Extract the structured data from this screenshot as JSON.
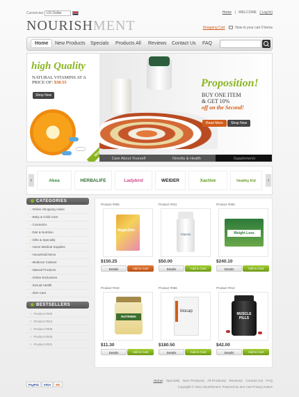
{
  "header": {
    "currencies_label": "Currencies:",
    "currency_value": "US Dollar",
    "logo_part1": "Nourish",
    "logo_part2": "ment",
    "links": {
      "home": "Home",
      "sep": "|",
      "welcome": "WELCOME",
      "login": "( Log In)"
    },
    "shopping_cart": "Shopping Cart",
    "cart_status": "Now in your cart 0 items"
  },
  "nav": {
    "items": [
      "Home",
      "New Products",
      "Specials",
      "Products All",
      "Reviews",
      "Contact Us",
      "FAQ"
    ],
    "search_placeholder": ""
  },
  "banner": {
    "left_title": "high Quality",
    "left_text": "NATURAL VITAMINS AT A PRICE OF:",
    "left_price": "$30.55",
    "left_button": "Shop Now",
    "new_tag": "New!",
    "right_title": "Proposition!",
    "right_line1": "BUY ONE ITEM",
    "right_line2": "& GET 10%",
    "right_line3": "off on the Second!",
    "read_more": "Read More",
    "shop_now": "Shop Now",
    "tabs": [
      "Care About Yourself",
      "Novelty & Health",
      "Supplements"
    ]
  },
  "brands": [
    "Akea",
    "HERBALIFE",
    "Ladybird",
    "WEIDER",
    "Xactive",
    "Healthy Kid"
  ],
  "sidebar": {
    "categories_title": "CATEGORIES",
    "categories": [
      "Online Shopping Aisles",
      "Baby & Child Care",
      "Cosmetics",
      "Diet & Nutrition",
      "Gifts & Specialty",
      "Home Medical Supplies",
      "Household Items",
      "Medicine Cabinet",
      "Natural Products",
      "Online Exclusives",
      "Sexual Health",
      "Skin Care"
    ],
    "bestsellers_title": "BESTSELLERS",
    "bestsellers": [
      {
        "num": "1",
        "name": "Product #025"
      },
      {
        "num": "2",
        "name": "Product #016"
      },
      {
        "num": "3",
        "name": "Product #008"
      },
      {
        "num": "4",
        "name": "Product #045"
      },
      {
        "num": "5",
        "name": "Product #001"
      }
    ]
  },
  "products": [
    {
      "code": "Product #005",
      "price": "$150.25",
      "label": "MagicSlim"
    },
    {
      "code": "Product #011",
      "price": "$50.00",
      "label": "Vitamin"
    },
    {
      "code": "Product #060",
      "price": "$240.10",
      "label": "Weight Loss"
    },
    {
      "code": "Product #042",
      "price": "$11.30",
      "label": "NUTRIMIX"
    },
    {
      "code": "Product #056",
      "price": "$180.50",
      "label": "biocap"
    },
    {
      "code": "Product #012",
      "price": "$42.00",
      "label": "MUSCLE PILLS"
    }
  ],
  "buttons": {
    "details": "Details",
    "add_to_cart": "Add to Cart"
  },
  "footer": {
    "payments": [
      "PayPal",
      "VISA",
      "MC"
    ],
    "links": [
      "Home",
      "Specials",
      "New Products",
      "All Products",
      "Reviews",
      "Contact Us",
      "FAQ"
    ],
    "copyright": "Copyright © 2011 Nourishment. Powered by Zen Cart Privacy Notice"
  },
  "colors": {
    "accent_green": "#8ab523",
    "accent_orange": "#d05c1a",
    "dark": "#333333"
  }
}
